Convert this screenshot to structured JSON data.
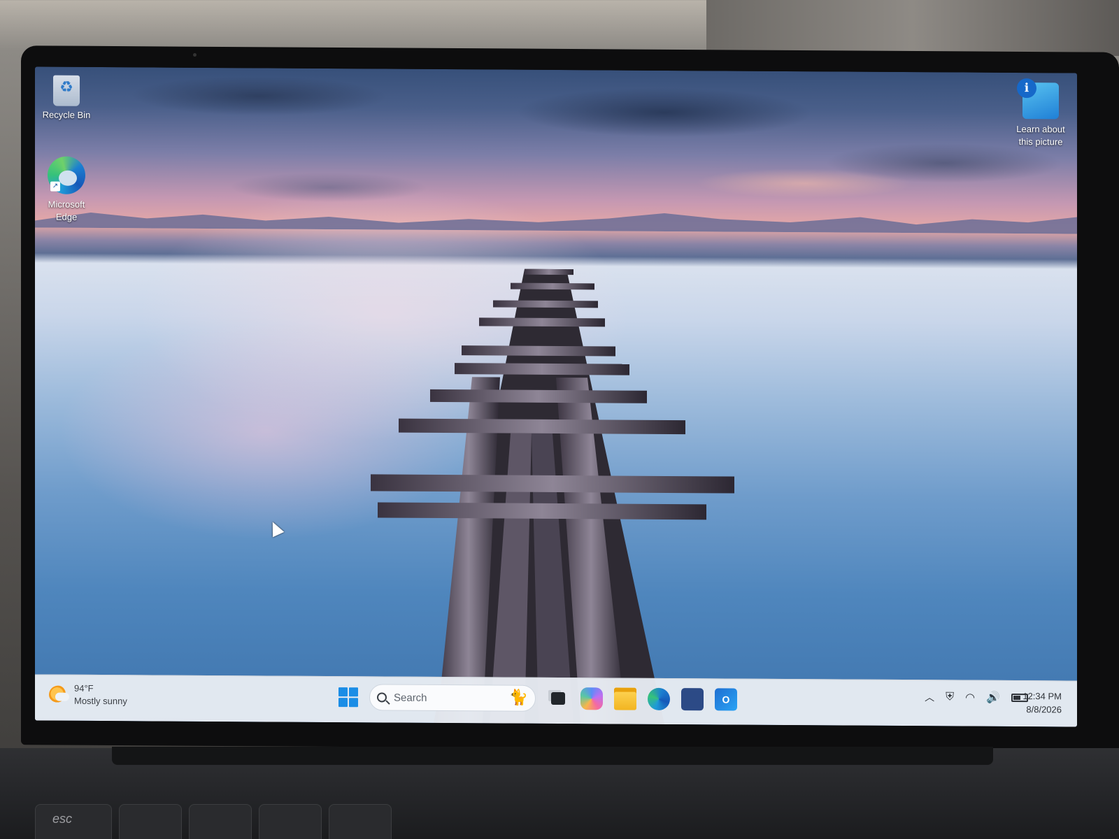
{
  "desktop": {
    "icons": [
      {
        "label": "Recycle Bin"
      },
      {
        "label": "Microsoft Edge"
      },
      {
        "label_line1": "Learn about",
        "label_line2": "this picture"
      }
    ]
  },
  "taskbar": {
    "weather": {
      "temperature": "94°F",
      "condition": "Mostly sunny"
    },
    "search": {
      "placeholder": "Search"
    },
    "pinned_apps": [
      "task-view",
      "copilot",
      "file-explorer",
      "microsoft-edge",
      "microsoft-store",
      "outlook"
    ],
    "tray": {
      "icons": [
        "chevron-up-icon",
        "security-icon",
        "wifi-icon",
        "volume-icon",
        "battery-icon"
      ]
    },
    "clock": {
      "time": "12:34 PM",
      "date": "8/8/2026"
    }
  },
  "keyboard": {
    "esc_label": "esc"
  },
  "colors": {
    "accent": "#1a8de6",
    "taskbar_bg": "#e8ecf2"
  }
}
